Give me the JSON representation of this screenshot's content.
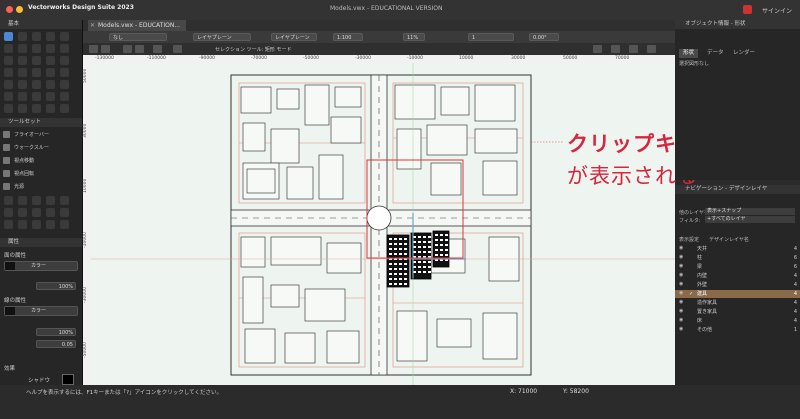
{
  "app": {
    "title": "Vectorworks Design Suite 2023",
    "document_title": "Models.vwx - EDUCATIONAL VERSION",
    "signin_label": "サインイン"
  },
  "tabs": [
    {
      "label": "Models.vwx - EDUCATION..."
    }
  ],
  "view_bar": {
    "class_field": "なし",
    "layer_field": "レイヤプレーン",
    "scale": "1:100",
    "zoom": "11%",
    "angle": "0.00°",
    "layer_label": "1"
  },
  "mode_bar": {
    "text": "セレクション ツール: 矩形 モード"
  },
  "left_panel": {
    "basic_header": "基本",
    "toolset_header": "ツールセット",
    "toolset_items": [
      "フライオーバー",
      "ウォークスルー",
      "視点移動",
      "視点回転",
      "光源"
    ],
    "attr_header": "属性",
    "fill_label": "面の属性",
    "fill_value": "カラー",
    "fill_opacity": "100%",
    "pen_label": "線の属性",
    "pen_value": "カラー",
    "pen_opacity": "100%",
    "line_weight": "0.05",
    "effects_label": "効果",
    "shadow_label": "シャドウ"
  },
  "obj_info": {
    "header": "オブジェクト情報 - 形状",
    "tabs": [
      "形状",
      "データ",
      "レンダー"
    ],
    "no_selection": "選択図形なし"
  },
  "nav_panel": {
    "header": "ナビゲーション - デザインレイヤ",
    "other_layers_label": "他のレイヤを:",
    "other_layers_value": "表示+スナップ",
    "filter_label": "フィルタ:",
    "filter_value": "+すべてのレイヤ",
    "col_visibility": "表示設定",
    "col_name": "デザインレイヤ名",
    "layers": [
      {
        "name": "天井",
        "num": "4"
      },
      {
        "name": "柱",
        "num": "6"
      },
      {
        "name": "梁",
        "num": "6"
      },
      {
        "name": "内壁",
        "num": "4"
      },
      {
        "name": "外壁",
        "num": "4"
      },
      {
        "name": "建具",
        "num": "4",
        "active": true
      },
      {
        "name": "造作家具",
        "num": "4"
      },
      {
        "name": "置き家具",
        "num": "4"
      },
      {
        "name": "床",
        "num": "4"
      },
      {
        "name": "その他",
        "num": "1"
      }
    ]
  },
  "ruler": {
    "top": [
      "-130000",
      "-110000",
      "-90000",
      "-70000",
      "-50000",
      "-30000",
      "-10000",
      "10000",
      "30000",
      "50000",
      "70000"
    ],
    "left": [
      "50000",
      "30000",
      "10000",
      "-10000",
      "-30000",
      "-50000"
    ]
  },
  "status": {
    "help": "ヘルプを表示するには、F1キーまたは「?」アイコンをクリックしてください。",
    "x": "X: 71000",
    "y": "Y: 58200"
  },
  "annotation": {
    "line1": "クリップキューブ",
    "line2": "が表示される"
  },
  "colors": {
    "accent": "#4c87d6",
    "annotation": "#d8243c",
    "clip_cube": "#d83a3a",
    "active_layer": "#8a6a48"
  }
}
